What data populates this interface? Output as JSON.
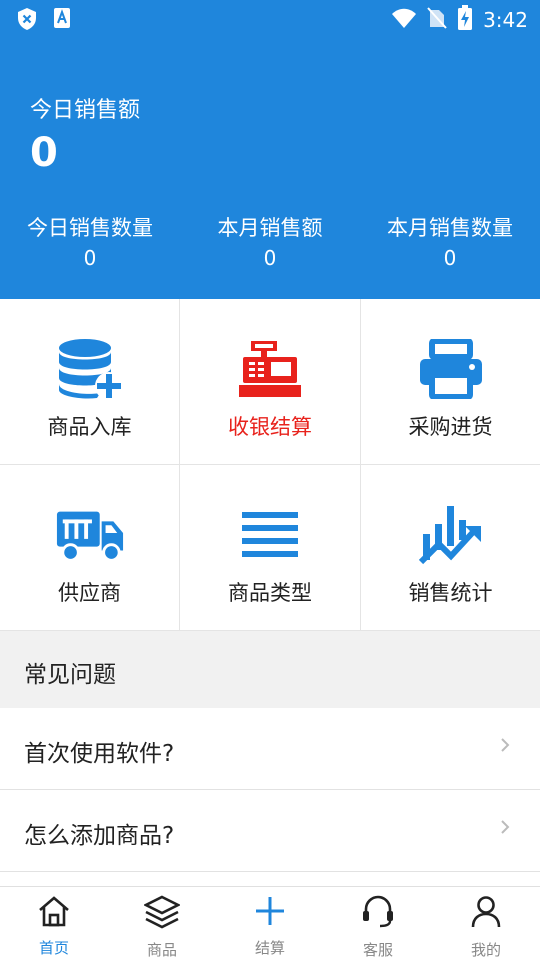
{
  "status_bar": {
    "time": "3:42"
  },
  "summary": {
    "today_sales_label": "今日销售额",
    "today_sales_value": "0",
    "stats": [
      {
        "label": "今日销售数量",
        "value": "0"
      },
      {
        "label": "本月销售额",
        "value": "0"
      },
      {
        "label": "本月销售数量",
        "value": "0"
      }
    ]
  },
  "grid": [
    {
      "label": "商品入库",
      "icon": "database-plus-icon"
    },
    {
      "label": "收银结算",
      "icon": "cash-register-icon"
    },
    {
      "label": "采购进货",
      "icon": "printer-icon"
    },
    {
      "label": "供应商",
      "icon": "truck-icon"
    },
    {
      "label": "商品类型",
      "icon": "list-lines-icon"
    },
    {
      "label": "销售统计",
      "icon": "chart-trend-icon"
    }
  ],
  "faq": {
    "title": "常见问题",
    "items": [
      {
        "question": "首次使用软件?"
      },
      {
        "question": "怎么添加商品?"
      }
    ]
  },
  "bottom_nav": [
    {
      "label": "首页",
      "icon": "home-icon"
    },
    {
      "label": "商品",
      "icon": "layers-icon"
    },
    {
      "label": "结算",
      "icon": "plus-icon"
    },
    {
      "label": "客服",
      "icon": "headset-icon"
    },
    {
      "label": "我的",
      "icon": "user-icon"
    }
  ],
  "colors": {
    "primary": "#1f86dc",
    "accent_red": "#e8221c",
    "icon_blue": "#1f86dc"
  }
}
